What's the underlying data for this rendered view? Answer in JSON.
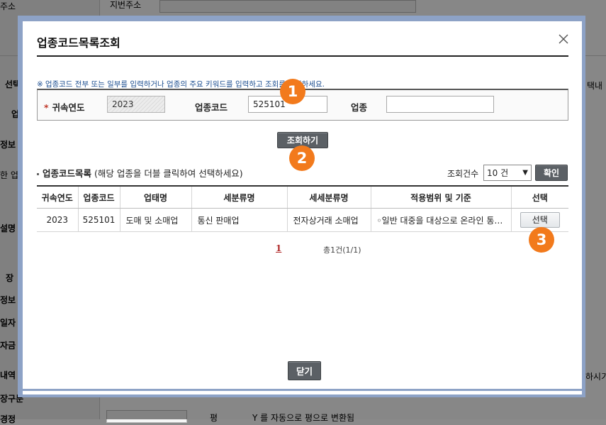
{
  "background": {
    "labels": [
      "주소",
      "지번주소",
      "선택",
      "업",
      "정보",
      "한 업",
      "설명",
      "장",
      "정보",
      "일자",
      "자금",
      "내역",
      "장구분",
      "경정",
      "택내",
      "하시기"
    ],
    "partial_text": "Y 를 자동으로 평으로 변환됨",
    "unit": "평"
  },
  "modal": {
    "title": "업종코드목록조회",
    "hint": "업종코드 전부 또는 일부를 입력하거나 업종의 주요 키워드를 입력하고 조회를 클릭하세요.",
    "hint_mark": "※",
    "search": {
      "year_label": "귀속연도",
      "year_required_mark": "*",
      "year_value": "2023",
      "code_label": "업종코드",
      "code_value": "525101",
      "industry_label": "업종",
      "industry_value": ""
    },
    "search_button": "조회하기",
    "list": {
      "title": "업종코드목록",
      "subtitle": "(해당 업종을 더블 클릭하여 선택하세요)",
      "count_label": "조회건수",
      "count_value": "10 건",
      "confirm_button": "확인"
    },
    "table": {
      "headers": [
        "귀속연도",
        "업종코드",
        "업태명",
        "세분류명",
        "세세분류명",
        "적용범위 및 기준",
        "선택"
      ],
      "rows": [
        {
          "year": "2023",
          "code": "525101",
          "business_type": "도매 및 소매업",
          "sub_class": "통신 판매업",
          "detail_class": "전자상거래 소매업",
          "scope": "◦일반 대중을 대상으로 온라인 통신망을 통하여",
          "select_label": "선택"
        }
      ]
    },
    "pager": {
      "current_page": "1",
      "total_text": "총1건(1/1)"
    },
    "close_button": "닫기"
  },
  "annotations": {
    "badge_1": "1",
    "badge_2": "2",
    "badge_3": "3",
    "badge_color": "#f27a1c"
  }
}
